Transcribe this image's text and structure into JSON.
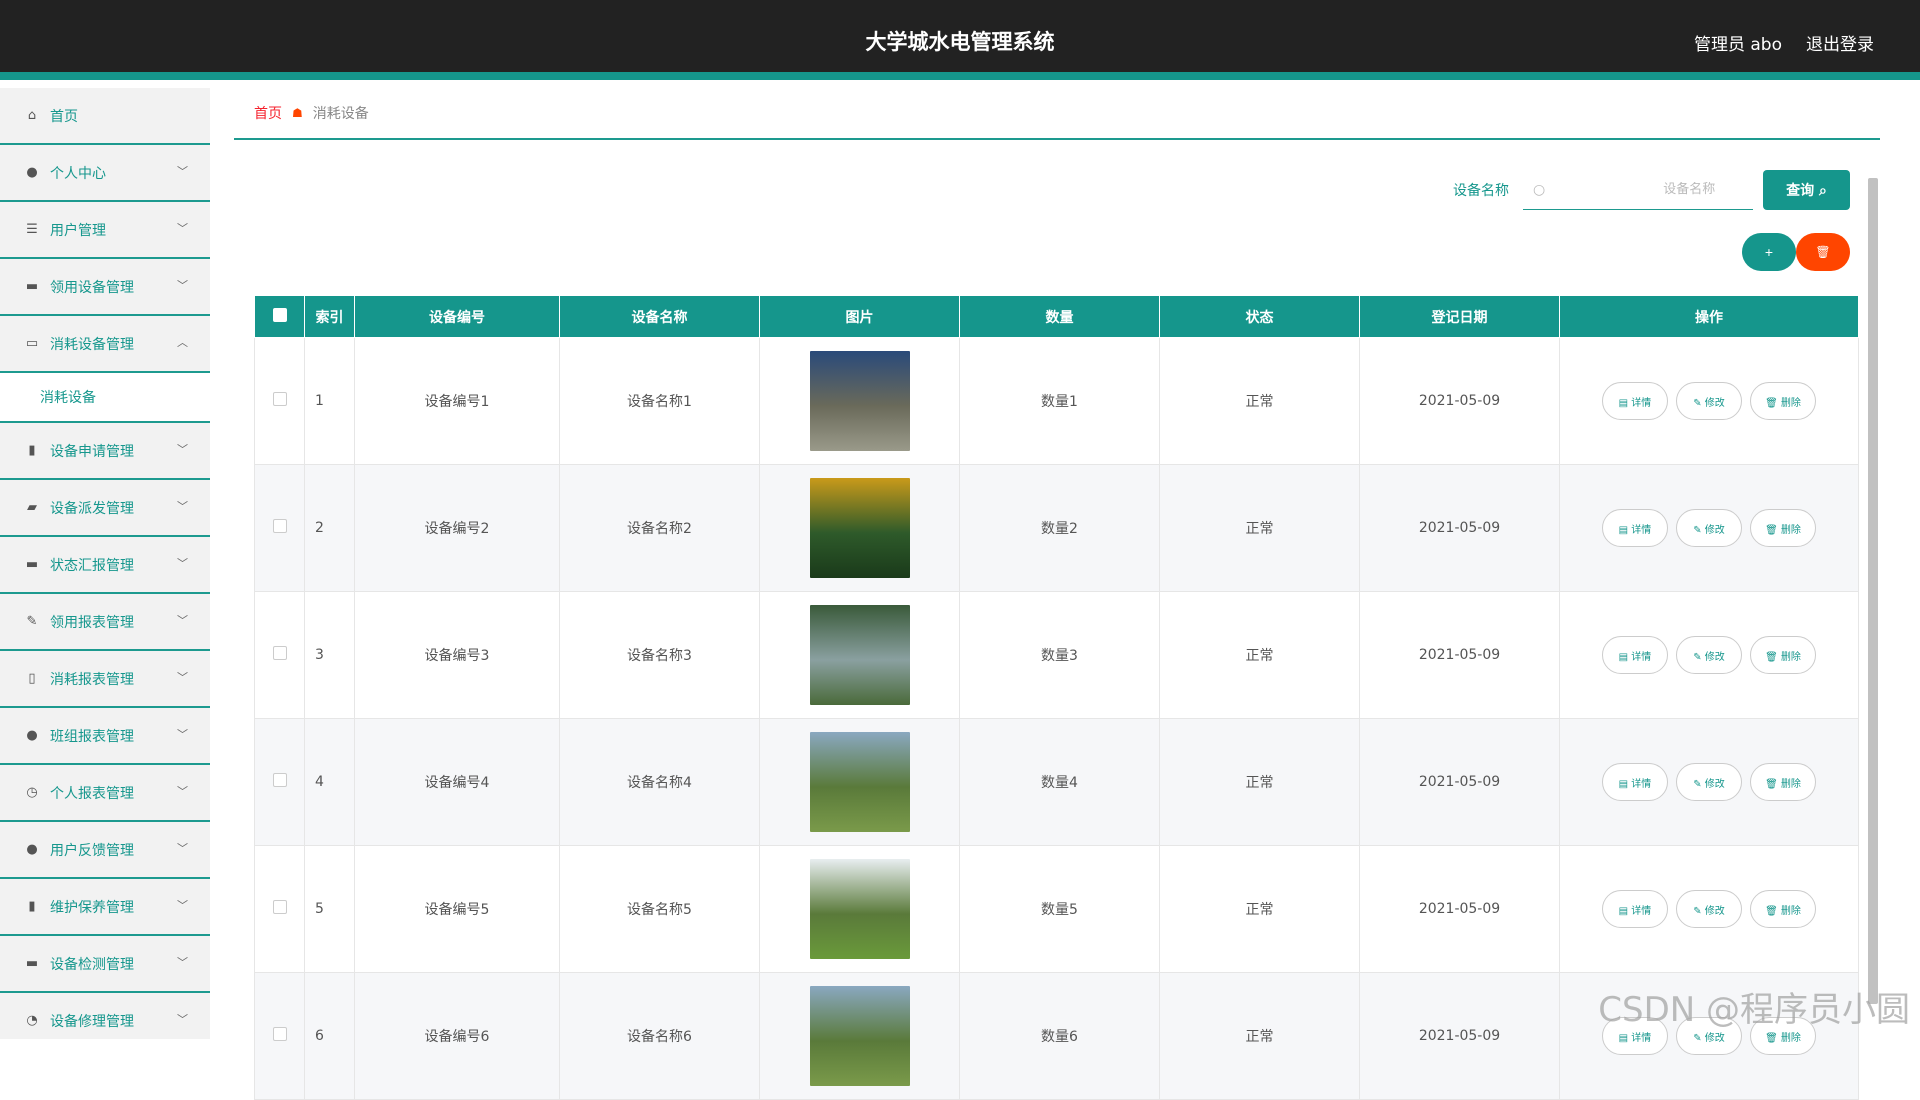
{
  "header": {
    "title": "大学城水电管理系统",
    "user_label": "管理员 abo",
    "logout_label": "退出登录"
  },
  "sidebar": {
    "items": [
      {
        "label": "首页",
        "icon": "home-icon",
        "glyph": "⌂"
      },
      {
        "label": "个人中心",
        "icon": "user-icon",
        "glyph": "●"
      },
      {
        "label": "用户管理",
        "icon": "list-icon",
        "glyph": "☰"
      },
      {
        "label": "领用设备管理",
        "icon": "chat-icon",
        "glyph": "▬"
      },
      {
        "label": "消耗设备管理",
        "icon": "message-icon",
        "glyph": "▭",
        "expanded": true,
        "subitems": [
          "消耗设备"
        ]
      },
      {
        "label": "设备申请管理",
        "icon": "bar-chart-icon",
        "glyph": "▮"
      },
      {
        "label": "设备派发管理",
        "icon": "wallet-icon",
        "glyph": "▰"
      },
      {
        "label": "状态汇报管理",
        "icon": "monitor-icon",
        "glyph": "▬"
      },
      {
        "label": "领用报表管理",
        "icon": "edit-icon",
        "glyph": "✎"
      },
      {
        "label": "消耗报表管理",
        "icon": "mic-icon",
        "glyph": "▯"
      },
      {
        "label": "班组报表管理",
        "icon": "user-icon",
        "glyph": "●"
      },
      {
        "label": "个人报表管理",
        "icon": "clock-icon",
        "glyph": "◷"
      },
      {
        "label": "用户反馈管理",
        "icon": "bulb-icon",
        "glyph": "●"
      },
      {
        "label": "维护保养管理",
        "icon": "chart-icon",
        "glyph": "▮"
      },
      {
        "label": "设备检测管理",
        "icon": "monitor-icon",
        "glyph": "▬"
      },
      {
        "label": "设备修理管理",
        "icon": "dashboard-icon",
        "glyph": "◔"
      }
    ]
  },
  "breadcrumb": {
    "home": "首页",
    "current": "消耗设备"
  },
  "search": {
    "label": "设备名称",
    "placeholder": "设备名称",
    "button_label": "查询 ⌕",
    "value": ""
  },
  "actions": {
    "add_label": "+",
    "delete_label": "🗑"
  },
  "table": {
    "columns": [
      "索引",
      "设备编号",
      "设备名称",
      "图片",
      "数量",
      "状态",
      "登记日期",
      "操作"
    ],
    "row_actions": {
      "detail": "▤ 详情",
      "edit": "✎ 修改",
      "delete": "🗑 删除"
    },
    "rows": [
      {
        "index": "1",
        "code": "设备编号1",
        "name": "设备名称1",
        "qty": "数量1",
        "status": "正常",
        "date": "2021-05-09",
        "img_colors": [
          "#2a4a7a",
          "#6a6a5a",
          "#9a9a8a"
        ]
      },
      {
        "index": "2",
        "code": "设备编号2",
        "name": "设备名称2",
        "qty": "数量2",
        "status": "正常",
        "date": "2021-05-09",
        "img_colors": [
          "#c99a1a",
          "#2e5a2a",
          "#1a3a1a"
        ]
      },
      {
        "index": "3",
        "code": "设备编号3",
        "name": "设备名称3",
        "qty": "数量3",
        "status": "正常",
        "date": "2021-05-09",
        "img_colors": [
          "#3a5a3a",
          "#8aa0a0",
          "#4a6a3a"
        ]
      },
      {
        "index": "4",
        "code": "设备编号4",
        "name": "设备名称4",
        "qty": "数量4",
        "status": "正常",
        "date": "2021-05-09",
        "img_colors": [
          "#8aa8c0",
          "#5a7a3a",
          "#7a9a4a"
        ]
      },
      {
        "index": "5",
        "code": "设备编号5",
        "name": "设备名称5",
        "qty": "数量5",
        "status": "正常",
        "date": "2021-05-09",
        "img_colors": [
          "#e8eef0",
          "#5a7a3a",
          "#6a9a3a"
        ]
      },
      {
        "index": "6",
        "code": "设备编号6",
        "name": "设备名称6",
        "qty": "数量6",
        "status": "正常",
        "date": "2021-05-09",
        "img_colors": [
          "#8aa8c0",
          "#5a7a3a",
          "#7a9a4a"
        ]
      }
    ]
  },
  "watermark": "CSDN @程序员小圆"
}
